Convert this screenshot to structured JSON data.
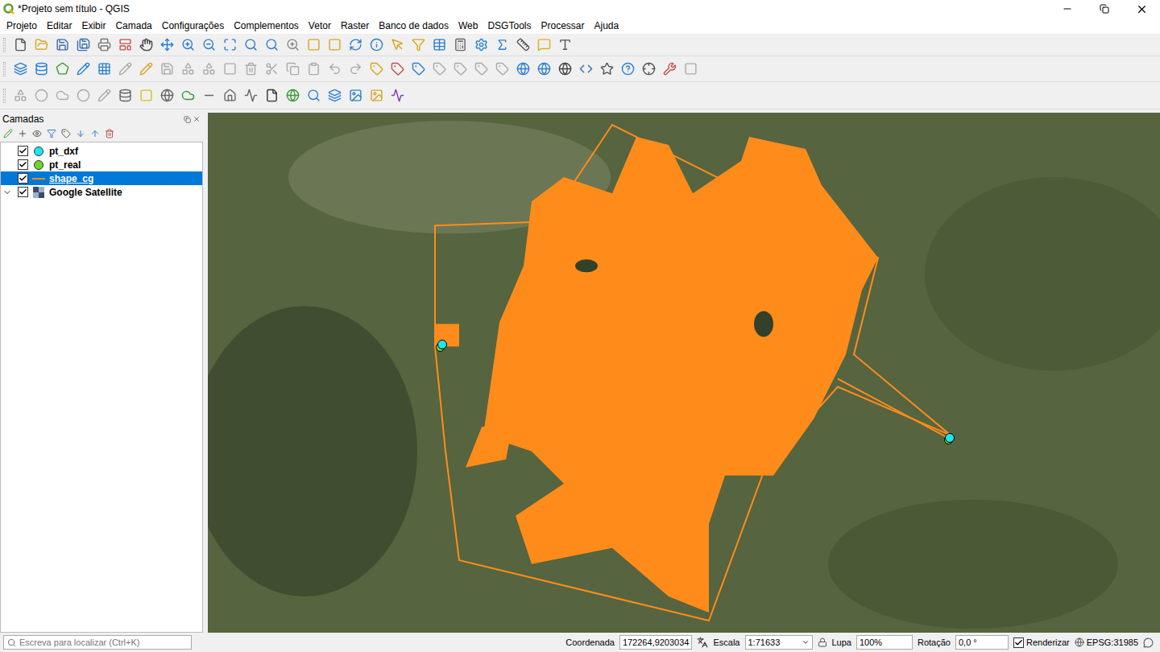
{
  "window": {
    "title": "*Projeto sem título - QGIS"
  },
  "menu": [
    "Projeto",
    "Editar",
    "Exibir",
    "Camada",
    "Configurações",
    "Complementos",
    "Vetor",
    "Raster",
    "Banco de dados",
    "Web",
    "DSGTools",
    "Processar",
    "Ajuda"
  ],
  "layers_panel": {
    "title": "Camadas",
    "layers": [
      {
        "name": "pt_dxf",
        "kind": "point",
        "color": "#1ee6f0",
        "checked": true,
        "selected": false,
        "current": false,
        "expanded": false
      },
      {
        "name": "pt_real",
        "kind": "point",
        "color": "#6ed62a",
        "checked": true,
        "selected": false,
        "current": false,
        "expanded": false
      },
      {
        "name": "shape_cg",
        "kind": "line",
        "color": "#ff8c1a",
        "checked": true,
        "selected": true,
        "current": true,
        "expanded": false
      },
      {
        "name": "Google Satellite",
        "kind": "raster",
        "color": "#3a4a6a",
        "checked": true,
        "selected": false,
        "current": false,
        "expanded": true
      }
    ]
  },
  "status_bar": {
    "search_placeholder": "Escreva para localizar (Ctrl+K)",
    "coordinate_label": "Coordenada",
    "coordinate": "172264,9203034",
    "scale_label": "Escala",
    "scale": "1:71633",
    "magnifier_label": "Lupa",
    "magnifier": "100%",
    "rotation_label": "Rotação",
    "rotation": "0,0 °",
    "render_label": "Renderizar",
    "render": true,
    "crs": "EPSG:31985"
  }
}
